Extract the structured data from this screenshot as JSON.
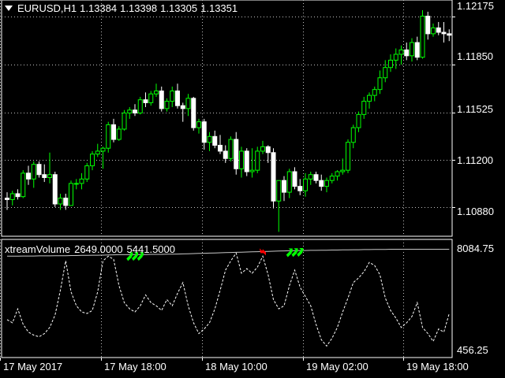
{
  "window": {
    "symbol": "EURUSD,H1",
    "ohlc": [
      "1.13384",
      "1.13398",
      "1.13305",
      "1.13351"
    ],
    "menu_icon": "triangle-down-icon"
  },
  "indicator": {
    "name": "xtreamVolume",
    "values": [
      "2649.0000",
      "5441.5000"
    ],
    "axis_max_label": "8084.75",
    "axis_min_label": "456.25"
  },
  "price_axis": [
    "1.12175",
    "1.11850",
    "1.11525",
    "1.11200",
    "1.10880"
  ],
  "time_axis": [
    "17 May 2017",
    "17 May 18:00",
    "18 May 10:00",
    "19 May 02:00",
    "19 May 18:00"
  ],
  "colors": {
    "background": "#000000",
    "frame": "#ffffff",
    "grid": "#c0c0c0",
    "bull": "#00ff00",
    "bear": "#ffffff",
    "signal_up": "#00ff00",
    "signal_down": "#ff0000",
    "volume_line": "#ffffff",
    "level_line": "#c8c8c8"
  },
  "chart_data": [
    {
      "type": "candlestick",
      "symbol": "EURUSD",
      "timeframe": "H1",
      "ylim": [
        1.1068,
        1.1229
      ],
      "yticks": [
        1.12175,
        1.1185,
        1.11525,
        1.112,
        1.1088
      ],
      "candles": [
        [
          1.1094,
          1.1098,
          1.1086,
          1.1093
        ],
        [
          1.1093,
          1.1099,
          1.1089,
          1.1097
        ],
        [
          1.1097,
          1.11,
          1.1093,
          1.1095
        ],
        [
          1.1095,
          1.1113,
          1.1094,
          1.1111
        ],
        [
          1.1111,
          1.1116,
          1.1103,
          1.1107
        ],
        [
          1.1107,
          1.1119,
          1.1101,
          1.1117
        ],
        [
          1.1117,
          1.1119,
          1.1108,
          1.111
        ],
        [
          1.111,
          1.1117,
          1.1105,
          1.1108
        ],
        [
          1.1108,
          1.1125,
          1.1104,
          1.111
        ],
        [
          1.111,
          1.1112,
          1.1088,
          1.109
        ],
        [
          1.109,
          1.1097,
          1.1086,
          1.1094
        ],
        [
          1.1094,
          1.1097,
          1.1086,
          1.1089
        ],
        [
          1.1089,
          1.1106,
          1.1089,
          1.1104
        ],
        [
          1.1104,
          1.1107,
          1.11,
          1.1104
        ],
        [
          1.1104,
          1.1111,
          1.11,
          1.1107
        ],
        [
          1.1107,
          1.1118,
          1.1105,
          1.1116
        ],
        [
          1.1116,
          1.1126,
          1.1113,
          1.1124
        ],
        [
          1.1124,
          1.1131,
          1.1122,
          1.1126
        ],
        [
          1.1126,
          1.1129,
          1.1114,
          1.1128
        ],
        [
          1.1128,
          1.1146,
          1.1125,
          1.1144
        ],
        [
          1.1144,
          1.1148,
          1.1132,
          1.1134
        ],
        [
          1.1134,
          1.1143,
          1.1133,
          1.1141
        ],
        [
          1.1141,
          1.1154,
          1.114,
          1.1152
        ],
        [
          1.1152,
          1.1156,
          1.1148,
          1.1154
        ],
        [
          1.1154,
          1.1158,
          1.115,
          1.1152
        ],
        [
          1.1152,
          1.1163,
          1.1151,
          1.1161
        ],
        [
          1.1161,
          1.1166,
          1.1156,
          1.1159
        ],
        [
          1.1159,
          1.1167,
          1.1157,
          1.1165
        ],
        [
          1.1165,
          1.1172,
          1.1163,
          1.1167
        ],
        [
          1.1167,
          1.117,
          1.1153,
          1.1155
        ],
        [
          1.1155,
          1.1162,
          1.1153,
          1.116
        ],
        [
          1.116,
          1.117,
          1.1156,
          1.1167
        ],
        [
          1.1167,
          1.1172,
          1.1155,
          1.1157
        ],
        [
          1.1157,
          1.1159,
          1.1146,
          1.1155
        ],
        [
          1.1155,
          1.1165,
          1.115,
          1.1162
        ],
        [
          1.1162,
          1.1163,
          1.114,
          1.1142
        ],
        [
          1.1142,
          1.1148,
          1.1138,
          1.1146
        ],
        [
          1.1146,
          1.1148,
          1.1127,
          1.1132
        ],
        [
          1.1132,
          1.1139,
          1.1126,
          1.1136
        ],
        [
          1.1136,
          1.114,
          1.1128,
          1.113
        ],
        [
          1.113,
          1.1137,
          1.1124,
          1.1126
        ],
        [
          1.1126,
          1.113,
          1.1118,
          1.1121
        ],
        [
          1.1121,
          1.1136,
          1.1119,
          1.1134
        ],
        [
          1.1134,
          1.1139,
          1.111,
          1.1114
        ],
        [
          1.1114,
          1.1129,
          1.1108,
          1.1126
        ],
        [
          1.1126,
          1.1128,
          1.1109,
          1.1112
        ],
        [
          1.1112,
          1.1128,
          1.1108,
          1.1113
        ],
        [
          1.1113,
          1.1129,
          1.1111,
          1.1126
        ],
        [
          1.1126,
          1.1133,
          1.1124,
          1.1129
        ],
        [
          1.1129,
          1.113,
          1.1118,
          1.1125
        ],
        [
          1.1125,
          1.1128,
          1.1087,
          1.1092
        ],
        [
          1.1092,
          1.1102,
          1.1071,
          1.1106
        ],
        [
          1.1106,
          1.1109,
          1.1092,
          1.1098
        ],
        [
          1.1098,
          1.1114,
          1.1094,
          1.1112
        ],
        [
          1.1112,
          1.1115,
          1.11,
          1.1102
        ],
        [
          1.1102,
          1.1107,
          1.1096,
          1.1099
        ],
        [
          1.1099,
          1.1111,
          1.1095,
          1.1107
        ],
        [
          1.1107,
          1.1112,
          1.1103,
          1.111
        ],
        [
          1.111,
          1.1112,
          1.1104,
          1.1106
        ],
        [
          1.1106,
          1.111,
          1.1099,
          1.1102
        ],
        [
          1.1102,
          1.1108,
          1.1098,
          1.1106
        ],
        [
          1.1106,
          1.1111,
          1.1104,
          1.1109
        ],
        [
          1.1109,
          1.1113,
          1.1106,
          1.1112
        ],
        [
          1.1112,
          1.1121,
          1.111,
          1.1113
        ],
        [
          1.1113,
          1.1134,
          1.1111,
          1.1132
        ],
        [
          1.1132,
          1.1144,
          1.1128,
          1.1142
        ],
        [
          1.1142,
          1.1153,
          1.1139,
          1.1151
        ],
        [
          1.1151,
          1.1163,
          1.1148,
          1.116
        ],
        [
          1.116,
          1.1166,
          1.1155,
          1.1164
        ],
        [
          1.1164,
          1.117,
          1.116,
          1.1168
        ],
        [
          1.1168,
          1.1181,
          1.1165,
          1.1176
        ],
        [
          1.1176,
          1.1188,
          1.1173,
          1.1183
        ],
        [
          1.1183,
          1.1192,
          1.118,
          1.1188
        ],
        [
          1.1188,
          1.1196,
          1.1182,
          1.1192
        ],
        [
          1.1192,
          1.1198,
          1.1185,
          1.1195
        ],
        [
          1.1195,
          1.12,
          1.1188,
          1.1191
        ],
        [
          1.1191,
          1.1203,
          1.1187,
          1.12
        ],
        [
          1.12,
          1.1204,
          1.1188,
          1.119
        ],
        [
          1.119,
          1.1222,
          1.1189,
          1.1218
        ],
        [
          1.1218,
          1.1221,
          1.1202,
          1.1206
        ],
        [
          1.1206,
          1.1213,
          1.1204,
          1.121
        ],
        [
          1.121,
          1.1214,
          1.1205,
          1.1207
        ],
        [
          1.1207,
          1.1214,
          1.12,
          1.1206
        ],
        [
          1.1206,
          1.1209,
          1.1201,
          1.1205
        ]
      ]
    },
    {
      "type": "line",
      "name": "xtreamVolume",
      "ylim": [
        456.25,
        8084.75
      ],
      "yticks": [
        8084.75,
        456.25
      ],
      "volume": [
        2900,
        2700,
        3600,
        2600,
        2100,
        1900,
        1800,
        2000,
        2400,
        3200,
        4800,
        6700,
        4700,
        3800,
        3400,
        3300,
        3500,
        4700,
        6700,
        7000,
        6800,
        5100,
        4000,
        3600,
        3400,
        3800,
        4500,
        4000,
        3800,
        3500,
        4200,
        3800,
        4600,
        5300,
        3800,
        2700,
        2000,
        2300,
        2700,
        3600,
        4800,
        6100,
        6700,
        7200,
        5900,
        6200,
        5900,
        6300,
        7000,
        5800,
        4200,
        3600,
        3800,
        5100,
        6100,
        5000,
        4400,
        3800,
        2600,
        1600,
        1200,
        1700,
        2400,
        3400,
        4300,
        5300,
        5600,
        6000,
        6600,
        6400,
        5800,
        4300,
        3500,
        3000,
        2400,
        2700,
        3100,
        4000,
        2400,
        2000,
        1500,
        2300,
        2100,
        3300
      ],
      "level": [
        7000,
        7000,
        7000,
        7010,
        7010,
        7010,
        7020,
        7020,
        7020,
        7030,
        7030,
        7030,
        7040,
        7040,
        7050,
        7050,
        7060,
        7060,
        7070,
        7080,
        7090,
        7100,
        7100,
        7100,
        7110,
        7110,
        7110,
        7120,
        7120,
        7120,
        7130,
        7130,
        7140,
        7150,
        7160,
        7170,
        7180,
        7190,
        7200,
        7210,
        7220,
        7230,
        7240,
        7250,
        7260,
        7270,
        7280,
        7290,
        7300,
        7310,
        7320,
        7330,
        7340,
        7350,
        7360,
        7370,
        7370,
        7380,
        7380,
        7390,
        7390,
        7400,
        7400,
        7410,
        7410,
        7420,
        7420,
        7430,
        7430,
        7440,
        7440,
        7440,
        7450,
        7450,
        7450,
        7450,
        7450,
        7450,
        7450,
        7450,
        7450,
        7450,
        7450,
        7450
      ],
      "signals": [
        {
          "index": 23,
          "direction": "up"
        },
        {
          "index": 24,
          "direction": "up"
        },
        {
          "index": 25,
          "direction": "up"
        },
        {
          "index": 48,
          "direction": "down"
        },
        {
          "index": 53,
          "direction": "up"
        },
        {
          "index": 54,
          "direction": "up"
        },
        {
          "index": 55,
          "direction": "up"
        }
      ]
    }
  ]
}
